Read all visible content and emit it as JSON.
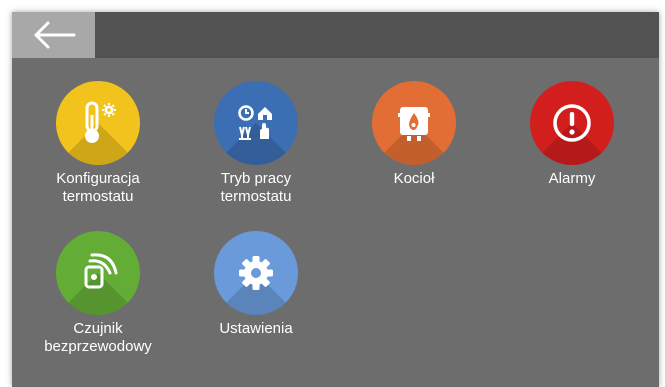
{
  "colors": {
    "topbar": "#525252",
    "background": "#6d6d6d",
    "back_button": "#a8a8a8",
    "yellow": "#f2c21d",
    "blue": "#3c6eb3",
    "orange": "#e36e35",
    "red": "#d31e1e",
    "green": "#63ad36",
    "light_blue": "#6a9ad9"
  },
  "back_icon": "arrow-left-icon",
  "tiles": [
    {
      "icon": "thermometer-gear-icon",
      "color": "#f2c21d",
      "label_line1": "Konfiguracja",
      "label_line2": "termostatu"
    },
    {
      "icon": "work-mode-icon",
      "color": "#3c6eb3",
      "label_line1": "Tryb pracy",
      "label_line2": "termostatu"
    },
    {
      "icon": "boiler-icon",
      "color": "#e36e35",
      "label_line1": "Kocioł",
      "label_line2": ""
    },
    {
      "icon": "alarm-icon",
      "color": "#d31e1e",
      "label_line1": "Alarmy",
      "label_line2": ""
    },
    {
      "icon": "wireless-sensor-icon",
      "color": "#63ad36",
      "label_line1": "Czujnik",
      "label_line2": "bezprzewodowy"
    },
    {
      "icon": "gear-icon",
      "color": "#6a9ad9",
      "label_line1": "Ustawienia",
      "label_line2": ""
    }
  ]
}
